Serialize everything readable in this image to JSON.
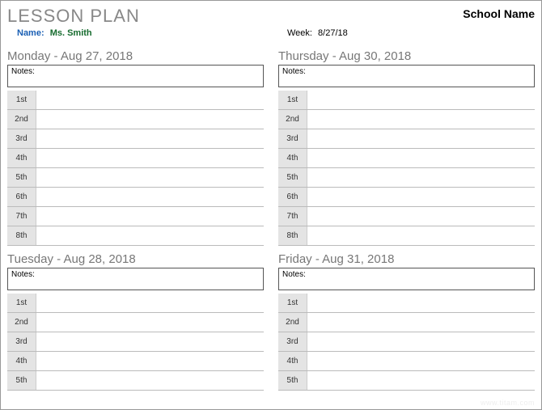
{
  "header": {
    "title": "LESSON PLAN",
    "school": "School Name",
    "name_label": "Name:",
    "teacher": "Ms. Smith",
    "week_label": "Week:",
    "week_value": "8/27/18"
  },
  "notes_label": "Notes:",
  "periods": [
    "1st",
    "2nd",
    "3rd",
    "4th",
    "5th",
    "6th",
    "7th",
    "8th"
  ],
  "periods_short": [
    "1st",
    "2nd",
    "3rd",
    "4th",
    "5th"
  ],
  "days": {
    "monday": {
      "title": "Monday - Aug 27, 2018"
    },
    "tuesday": {
      "title": "Tuesday - Aug 28, 2018"
    },
    "thursday": {
      "title": "Thursday - Aug 30, 2018"
    },
    "friday": {
      "title": "Friday - Aug 31, 2018"
    }
  },
  "watermark": "www.titam.com"
}
